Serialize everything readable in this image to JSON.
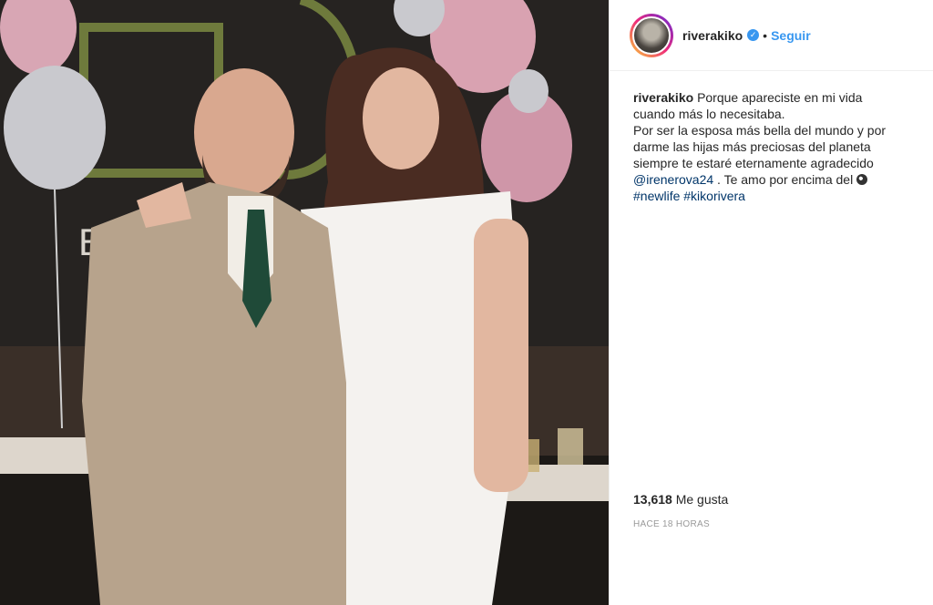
{
  "post": {
    "username": "riverakiko",
    "verified_icon": "verified-badge-icon",
    "separator": "•",
    "follow_label": "Seguir",
    "caption_username": "riverakiko",
    "caption_lines": [
      "Porque apareciste en mi vida",
      "cuando más lo necesitaba.",
      "Por ser la esposa más bella del mundo y por",
      "darme las hijas más preciosas del planeta",
      "siempre te estaré eternamente agradecido"
    ],
    "mention": "@irenerova24",
    "mention_suffix": " . Te amo por encima del",
    "hashtag1": "#newlife",
    "hashtag2": "#kikorivera",
    "likes_count": "13,618",
    "likes_label": "Me gusta",
    "timestamp": "HACE 18 HORAS"
  },
  "photo": {
    "sign_letter": "E",
    "colors": {
      "suit": "#b7a38c",
      "dress": "#f4f2ef",
      "balloon_pink": "#d9a2b1",
      "balloon_silver": "#c9c9ce",
      "wall": "#262321"
    }
  }
}
